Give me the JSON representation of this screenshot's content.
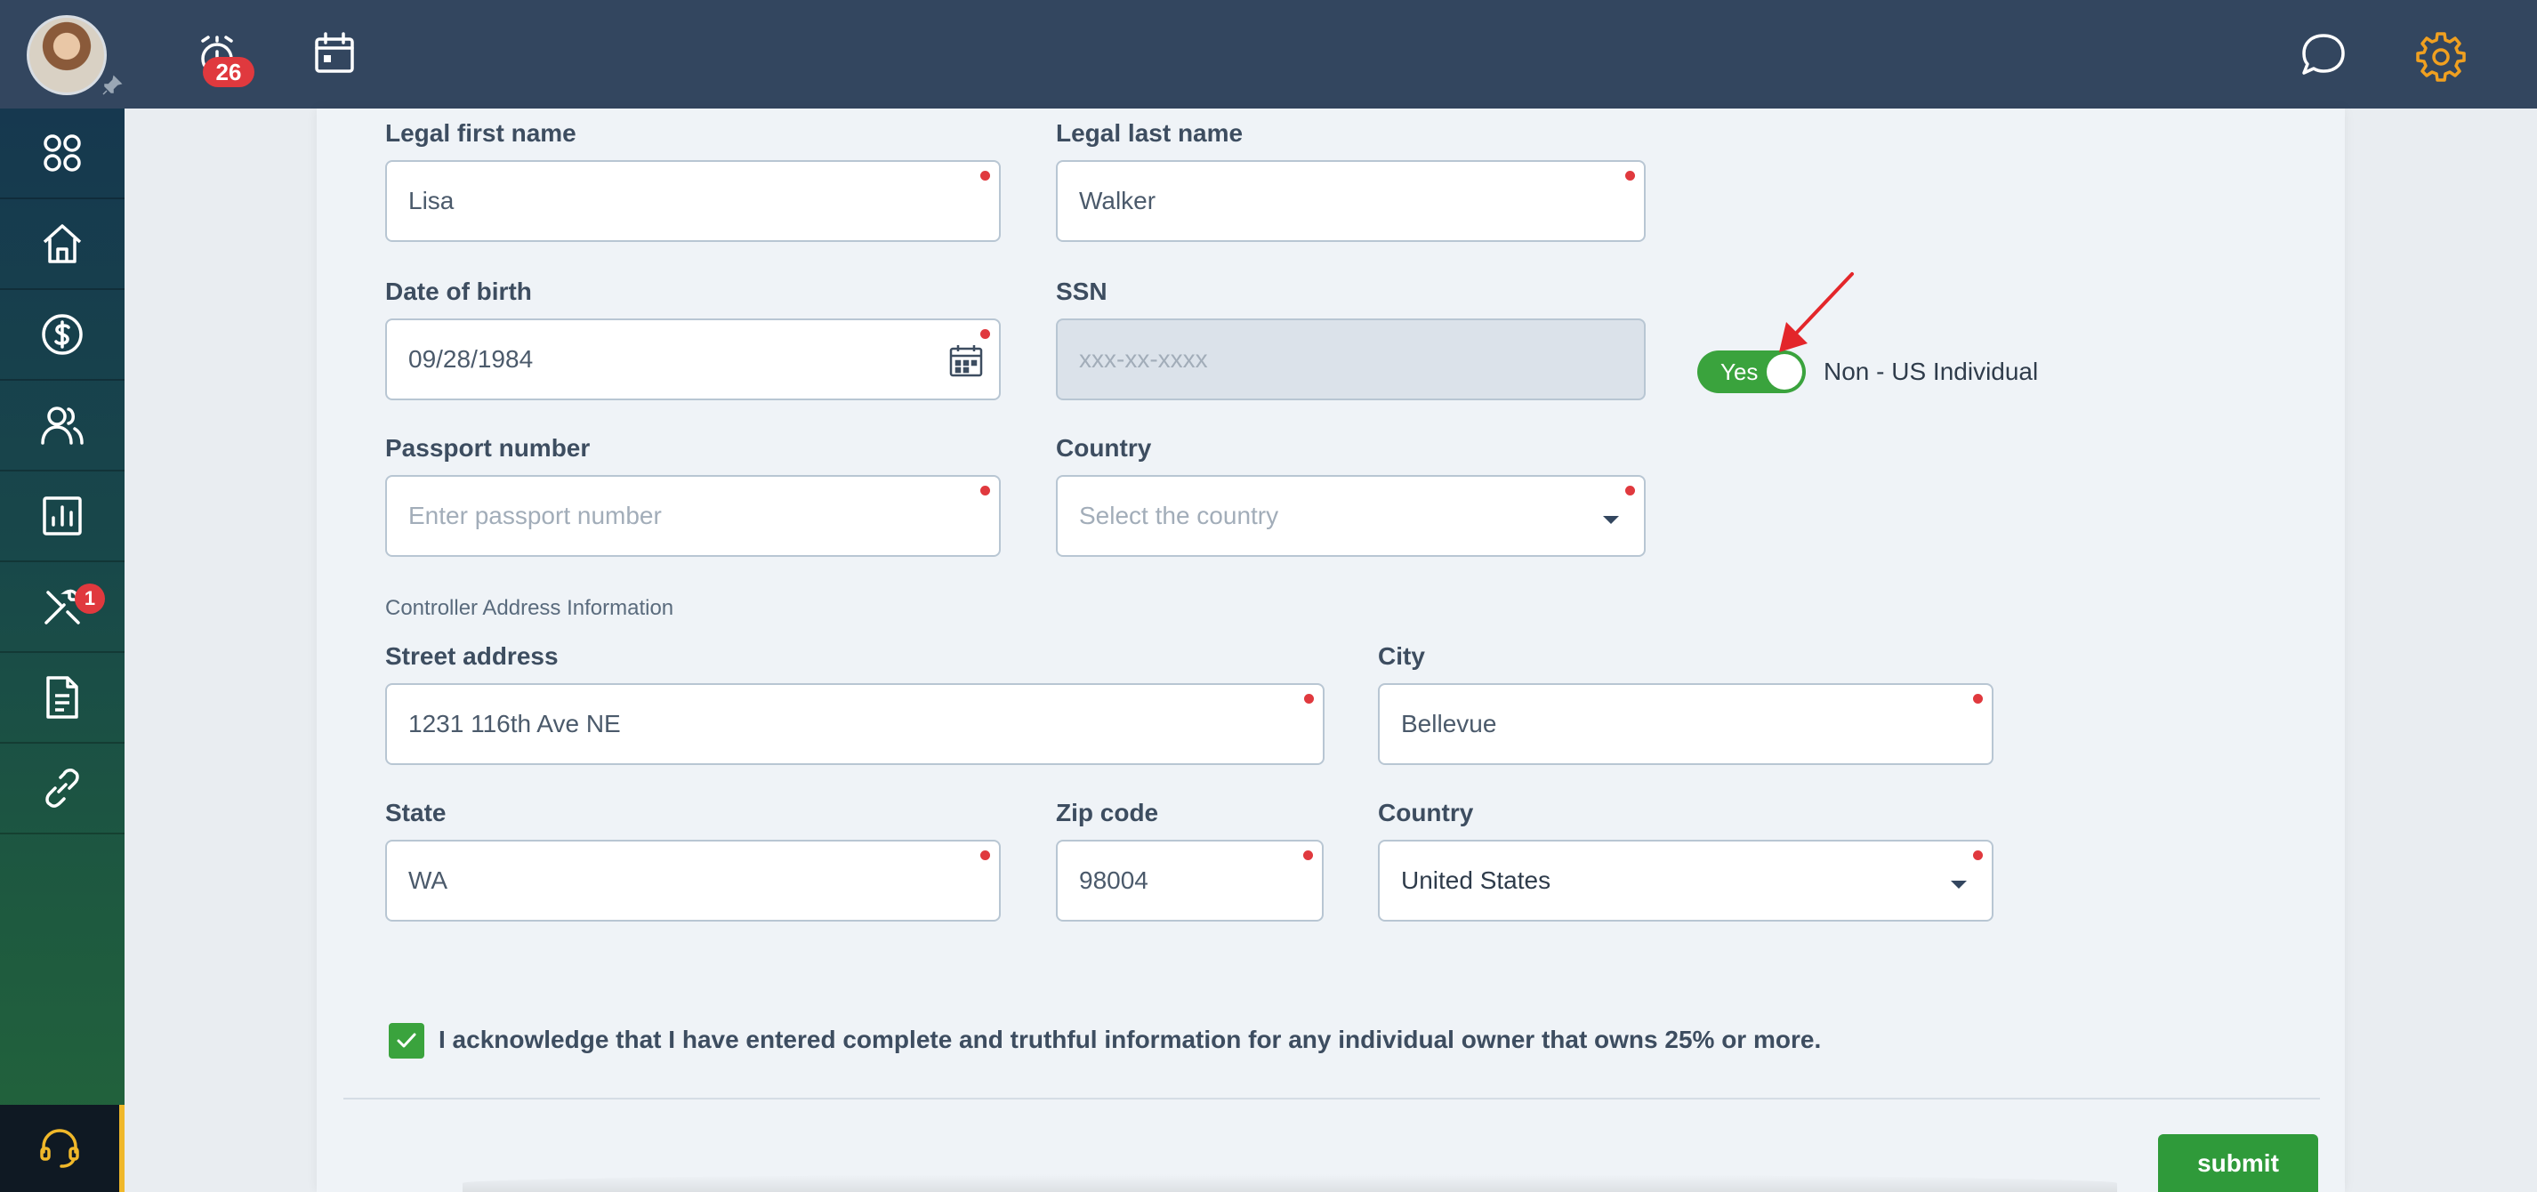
{
  "header": {
    "alarm_badge": "26",
    "icons": [
      "alarm-clock-icon",
      "calendar-icon",
      "chat-icon",
      "gear-icon"
    ],
    "accent_color": "#f0a020"
  },
  "sidebar": {
    "items": [
      {
        "icon": "apps-grid-icon"
      },
      {
        "icon": "home-icon"
      },
      {
        "icon": "dollar-icon"
      },
      {
        "icon": "users-icon"
      },
      {
        "icon": "report-chart-icon"
      },
      {
        "icon": "tools-icon",
        "badge": "1"
      },
      {
        "icon": "document-icon"
      },
      {
        "icon": "link-icon"
      }
    ],
    "support_icon": "headset-icon"
  },
  "form": {
    "first_name": {
      "label": "Legal first name",
      "value": "Lisa"
    },
    "last_name": {
      "label": "Legal last name",
      "value": "Walker"
    },
    "dob": {
      "label": "Date of birth",
      "value": "09/28/1984"
    },
    "ssn": {
      "label": "SSN",
      "placeholder": "xxx-xx-xxxx"
    },
    "toggle": {
      "state": "Yes",
      "label": "Non - US Individual"
    },
    "passport": {
      "label": "Passport number",
      "placeholder": "Enter passport number"
    },
    "country": {
      "label": "Country",
      "placeholder": "Select the country"
    },
    "address_section": "Controller Address Information",
    "street": {
      "label": "Street address",
      "value": "1231 116th Ave NE"
    },
    "city": {
      "label": "City",
      "value": "Bellevue"
    },
    "state": {
      "label": "State",
      "value": "WA"
    },
    "zip": {
      "label": "Zip code",
      "value": "98004"
    },
    "address_country": {
      "label": "Country",
      "value": "United States"
    },
    "acknowledge": "I acknowledge that I have entered complete and truthful information for any individual owner that owns 25% or more.",
    "submit_label": "submit"
  },
  "colors": {
    "topbar": "#33465f",
    "success": "#3aa33d",
    "required": "#e0393e"
  }
}
